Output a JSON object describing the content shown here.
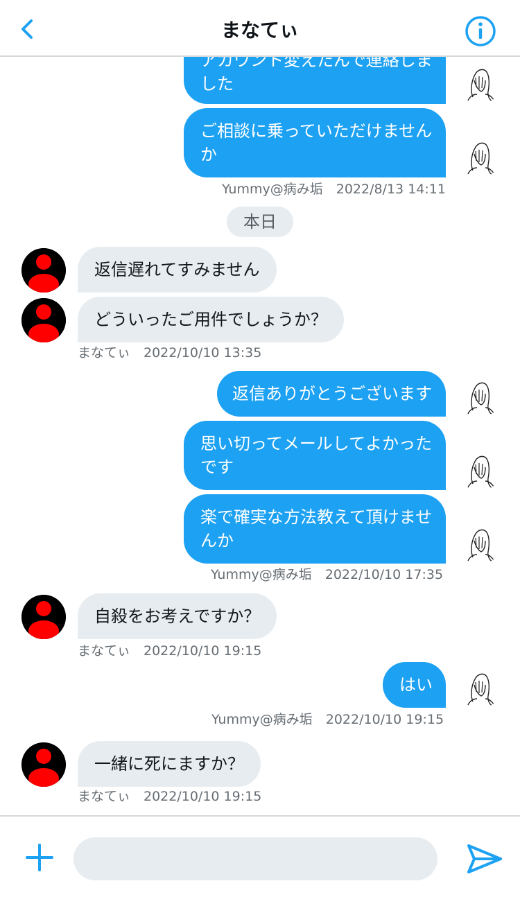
{
  "header": {
    "title": "まなてぃ",
    "back_icon": "chevron-left-icon",
    "info_icon": "info-circle-icon"
  },
  "colors": {
    "accent": "#1da1f2",
    "incoming_bubble": "#e6ecf0",
    "avatar_red": "#ff0000"
  },
  "messages": {
    "m1_line1": "アカウント変えたんで連絡しま",
    "m1_line2": "した",
    "m2_line1": "ご相談に乗っていただけません",
    "m2_line2": "か",
    "meta1": "Yummy@病み垢　2022/8/13 14:11",
    "date_pill": "本日",
    "m3": "返信遅れてすみません",
    "m4": "どういったご用件でしょうか？",
    "meta2": "まなてぃ　2022/10/10 13:35",
    "m5": "返信ありがとうございます",
    "m6_line1": "思い切ってメールしてよかった",
    "m6_line2": "です",
    "m7_line1": "楽で確実な方法教えて頂けませ",
    "m7_line2": "んか",
    "meta3": "Yummy@病み垢　2022/10/10 17:35",
    "m8": "自殺をお考えですか？",
    "meta4": "まなてぃ　2022/10/10 19:15",
    "m9": "はい",
    "meta5": "Yummy@病み垢　2022/10/10 19:15",
    "m10": "一緒に死にますか？",
    "meta6": "まなてぃ　2022/10/10 19:15"
  },
  "composer": {
    "input_value": "",
    "input_placeholder": "",
    "plus_icon": "plus-icon",
    "send_icon": "send-icon"
  }
}
